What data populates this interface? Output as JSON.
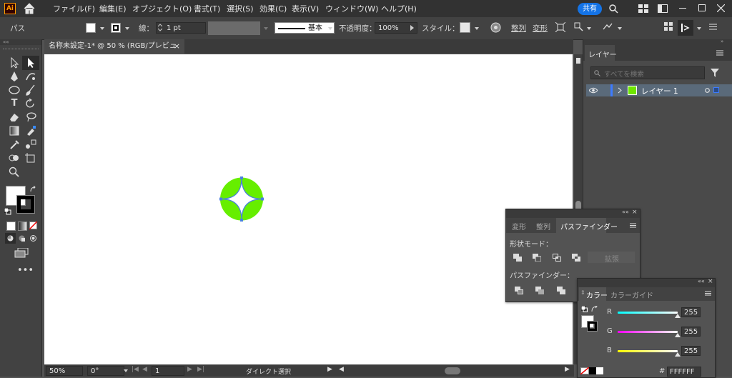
{
  "menubar": {
    "logo": "Ai",
    "items": [
      "ファイル(F)",
      "編集(E)",
      "オブジェクト(O)",
      "書式(T)",
      "選択(S)",
      "効果(C)",
      "表示(V)",
      "ウィンドウ(W)",
      "ヘルプ(H)"
    ],
    "share_label": "共有"
  },
  "control_bar": {
    "selection_type": "パス",
    "stroke_label": "線：",
    "stroke_weight": "1 pt",
    "brush_label": "基本",
    "opacity_label": "不透明度：",
    "opacity_value": "100%",
    "style_label": "スタイル：",
    "align_label": "整列",
    "transform_label": "変形"
  },
  "document": {
    "tab_title": "名称未設定-1* @ 50 % (RGB/プレビュー)",
    "close_glyph": "×"
  },
  "status_bar": {
    "zoom": "50%",
    "rotation": "0°",
    "artboard_number": "1",
    "current_tool": "ダイレクト選択"
  },
  "layers_panel": {
    "tab": "レイヤー",
    "search_placeholder": "すべてを検索",
    "layers": [
      {
        "name": "レイヤー 1"
      }
    ]
  },
  "pathfinder_panel": {
    "tabs": [
      "変形",
      "整列",
      "パスファインダー"
    ],
    "shape_modes_label": "形状モード：",
    "expand_label": "拡張",
    "pathfinders_label": "パスファインダー："
  },
  "color_panel": {
    "tabs": [
      "カラー",
      "カラーガイド"
    ],
    "channels": [
      {
        "name": "R",
        "value": "255",
        "color": "#00d8e6"
      },
      {
        "name": "G",
        "value": "255",
        "color": "#e632e6"
      },
      {
        "name": "B",
        "value": "255",
        "color": "#f0f000"
      }
    ],
    "hash": "#",
    "hex": "FFFFFF"
  },
  "colors": {
    "fill": "#ffffff",
    "stroke": "#000000",
    "shape_fill": "#66ee00",
    "selection_blue": "#4a7fe0",
    "accent": "#1473e6"
  }
}
